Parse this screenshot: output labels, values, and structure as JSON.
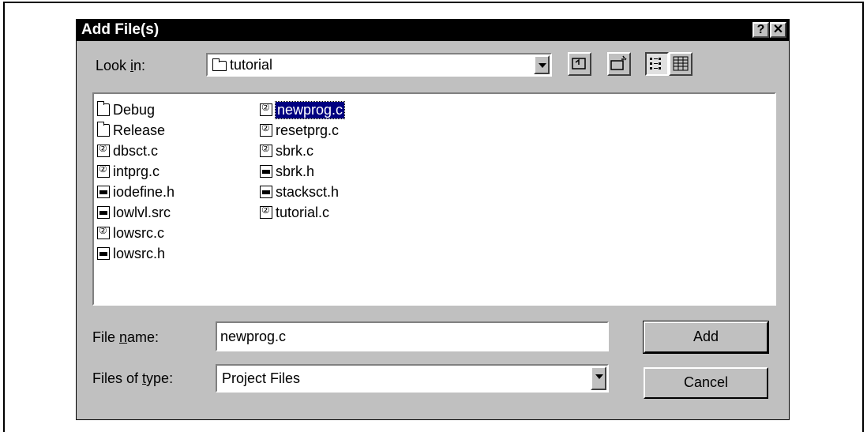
{
  "dialog": {
    "title": "Add File(s)",
    "help_button": "?",
    "close_button": "✕"
  },
  "look_in": {
    "label": "Look in:",
    "value": "tutorial"
  },
  "file_list": {
    "column1": [
      {
        "name": "Debug",
        "type": "folder"
      },
      {
        "name": "Release",
        "type": "folder"
      },
      {
        "name": "dbsct.c",
        "type": "c-file"
      },
      {
        "name": "intprg.c",
        "type": "c-file"
      },
      {
        "name": "iodefine.h",
        "type": "h-file"
      },
      {
        "name": "lowlvl.src",
        "type": "h-file"
      },
      {
        "name": "lowsrc.c",
        "type": "c-file"
      },
      {
        "name": "lowsrc.h",
        "type": "h-file"
      }
    ],
    "column2": [
      {
        "name": "newprog.c",
        "type": "c-file",
        "selected": true
      },
      {
        "name": "resetprg.c",
        "type": "c-file"
      },
      {
        "name": "sbrk.c",
        "type": "c-file"
      },
      {
        "name": "sbrk.h",
        "type": "h-file"
      },
      {
        "name": "stacksct.h",
        "type": "h-file"
      },
      {
        "name": "tutorial.c",
        "type": "c-file"
      }
    ]
  },
  "file_name": {
    "label": "File name:",
    "value": "newprog.c"
  },
  "file_type": {
    "label": "Files of type:",
    "value": "Project Files"
  },
  "buttons": {
    "add": "Add",
    "cancel": "Cancel"
  },
  "colors": {
    "dialog_bg": "#c0c0c0",
    "titlebar_bg": "#000000",
    "selection": "#000080"
  }
}
